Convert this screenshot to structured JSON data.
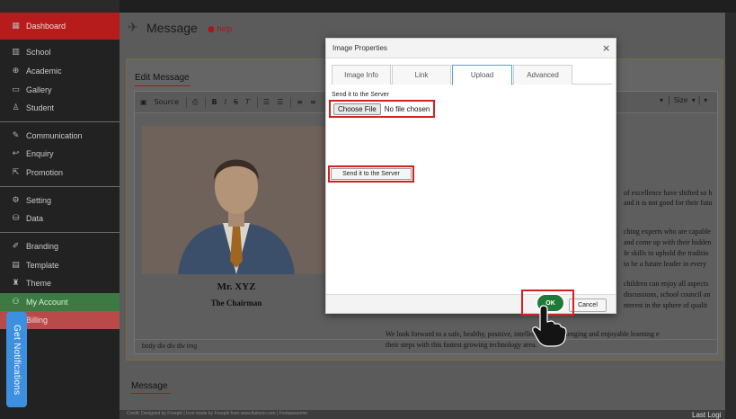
{
  "sidebar": {
    "items": [
      {
        "label": "Dashboard",
        "icon": "grid-icon"
      },
      {
        "label": "School",
        "icon": "building-icon"
      },
      {
        "label": "Academic",
        "icon": "globe-icon"
      },
      {
        "label": "Gallery",
        "icon": "image-icon"
      },
      {
        "label": "Student",
        "icon": "user-icon"
      },
      {
        "label": "Communication",
        "icon": "pen-icon"
      },
      {
        "label": "Enquiry",
        "icon": "reply-icon"
      },
      {
        "label": "Promotion",
        "icon": "share-icon"
      },
      {
        "label": "Setting",
        "icon": "gear-icon"
      },
      {
        "label": "Data",
        "icon": "database-icon"
      },
      {
        "label": "Branding",
        "icon": "brush-icon"
      },
      {
        "label": "Template",
        "icon": "template-icon"
      },
      {
        "label": "Theme",
        "icon": "theme-icon"
      },
      {
        "label": "My Account",
        "icon": "account-icon"
      },
      {
        "label": "Billing",
        "icon": "billing-icon"
      }
    ]
  },
  "notification_tab": {
    "label": "Get Notifications"
  },
  "header": {
    "title": "Message",
    "help": "help"
  },
  "edit_card": {
    "label": "Edit Message"
  },
  "toolbar": {
    "source_label": "Source",
    "size_label": "Size"
  },
  "photo": {
    "name": "Mr. XYZ",
    "role": "The Chairman"
  },
  "body_text": {
    "lines_right": [
      "of excellence have shifted so h",
      "and it is not good for their futu",
      "ching experts who are capable",
      "and come up with their hidden",
      "fe skills to uphold the traditio",
      "to be a future leader in every",
      "children can enjoy all aspects",
      "discussions, school council an",
      "nterest in the sphere of qualit"
    ],
    "line_bottom_1": "We look forward to a safe, healthy, positive, intellectually challenging and enjoyable learning e",
    "line_bottom_2": "their steps with this fastest growing technology area."
  },
  "path_bar": {
    "text": "body  div  div  div  img"
  },
  "message_section": {
    "label": "Message"
  },
  "footer": {
    "credit": "Credit: Designed by Freepik | Icon made by Freepik from www.flaticon.com | Fontawesome",
    "right": "Last Logi"
  },
  "modal": {
    "title": "Image Properties",
    "close": "×",
    "tabs": [
      "Image Info",
      "Link",
      "Upload",
      "Advanced"
    ],
    "active_tab": "Upload",
    "upload_label": "Send it to the Server",
    "choose_file": "Choose File",
    "no_file": "No file chosen",
    "send_button": "Send it to the Server",
    "ok": "OK",
    "cancel": "Cancel"
  },
  "colors": {
    "accent_red": "#d32020",
    "sidebar_active": "#b71c1c",
    "tab_active_border": "#4fa2d8"
  }
}
